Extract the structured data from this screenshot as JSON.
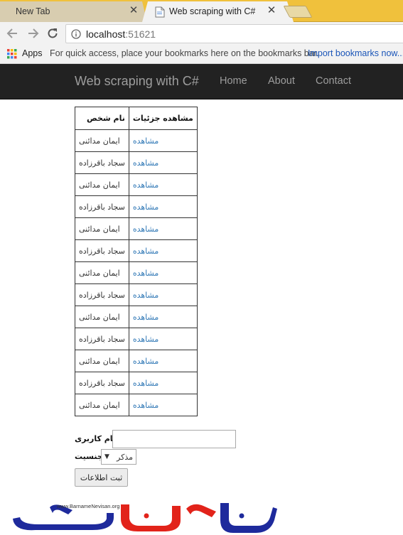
{
  "browser": {
    "tabs": [
      {
        "title": "New Tab",
        "active": false
      },
      {
        "title": "Web scraping with C#",
        "active": true
      }
    ],
    "url_host": "localhost",
    "url_port": ":51621",
    "bookmarks": {
      "apps_label": "Apps",
      "hint": "For quick access, place your bookmarks here on the bookmarks bar.",
      "import_link": "Import bookmarks now..."
    }
  },
  "navbar": {
    "brand": "Web scraping with C#",
    "links": [
      "Home",
      "About",
      "Contact"
    ]
  },
  "table": {
    "headers": {
      "details": "مشاهده جزئیات",
      "name": "نام شخص"
    },
    "view_label": "مشاهده",
    "rows": [
      "ایمان مدائنی",
      "سجاد باقرزاده",
      "ایمان مدائنی",
      "سجاد باقرزاده",
      "ایمان مدائنی",
      "سجاد باقرزاده",
      "ایمان مدائنی",
      "سجاد باقرزاده",
      "ایمان مدائنی",
      "سجاد باقرزاده",
      "ایمان مدائنی",
      "سجاد باقرزاده",
      "ایمان مدائنی"
    ]
  },
  "form": {
    "username_label": "نام کاربری",
    "username_value": "",
    "gender_label": "جنسیت",
    "gender_selected": "مذکر",
    "submit_label": "ثبت اطلاعات"
  },
  "logo": {
    "url_text": "www.BarnameNevisan.org",
    "wordmark": "برنامه نویسان"
  },
  "colors": {
    "tab_strip": "#f0c13c",
    "navbar_bg": "#222222",
    "navbar_text": "#9d9d9d",
    "link": "#337ab7",
    "logo_blue": "#1e2a9c",
    "logo_red": "#e2231a"
  }
}
